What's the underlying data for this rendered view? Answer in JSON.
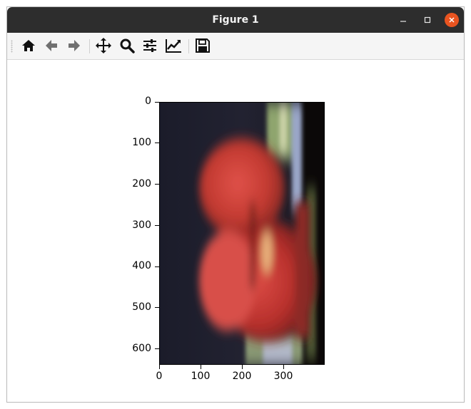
{
  "window": {
    "title": "Figure 1"
  },
  "toolbar": {
    "tools": [
      {
        "name": "home",
        "icon": "home-icon"
      },
      {
        "name": "back",
        "icon": "arrow-left-icon"
      },
      {
        "name": "forward",
        "icon": "arrow-right-icon"
      },
      {
        "name": "pan",
        "icon": "move-icon"
      },
      {
        "name": "zoom",
        "icon": "magnifier-icon"
      },
      {
        "name": "subplots",
        "icon": "sliders-icon"
      },
      {
        "name": "edit-axes",
        "icon": "line-chart-icon"
      },
      {
        "name": "save",
        "icon": "floppy-disk-icon"
      }
    ]
  },
  "plot": {
    "y_ticks": [
      "0",
      "100",
      "200",
      "300",
      "400",
      "500",
      "600"
    ],
    "x_ticks": [
      "0",
      "100",
      "200",
      "300"
    ],
    "image_description_colors": {
      "background": "#1a1b27",
      "tomato": "#c8372f",
      "highlight": "#e7b07a",
      "stems": "#6e8d4b",
      "bluish": "#9aa6c8"
    }
  }
}
